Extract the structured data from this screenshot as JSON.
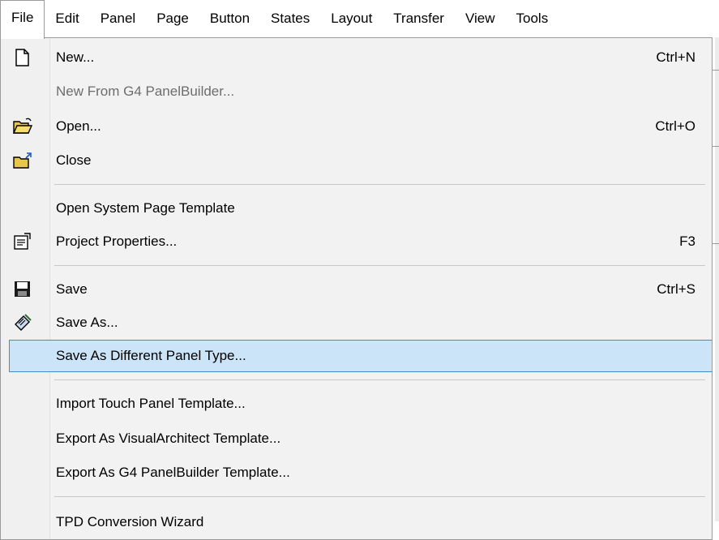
{
  "menubar": {
    "items": [
      {
        "label": "File"
      },
      {
        "label": "Edit"
      },
      {
        "label": "Panel"
      },
      {
        "label": "Page"
      },
      {
        "label": "Button"
      },
      {
        "label": "States"
      },
      {
        "label": "Layout"
      },
      {
        "label": "Transfer"
      },
      {
        "label": "View"
      },
      {
        "label": "Tools"
      }
    ]
  },
  "file_menu": {
    "items": [
      {
        "label": "New...",
        "shortcut": "Ctrl+N",
        "icon": "new-file-icon"
      },
      {
        "label": "New From G4 PanelBuilder...",
        "disabled": true
      },
      {
        "label": "Open...",
        "shortcut": "Ctrl+O",
        "icon": "open-folder-icon"
      },
      {
        "label": "Close",
        "icon": "close-folder-icon"
      },
      {
        "label": "Open System Page Template"
      },
      {
        "label": "Project Properties...",
        "shortcut": "F3",
        "icon": "properties-icon"
      },
      {
        "label": "Save",
        "shortcut": "Ctrl+S",
        "icon": "save-disk-icon"
      },
      {
        "label": "Save As...",
        "icon": "save-as-icon"
      },
      {
        "label": "Save As Different Panel Type...",
        "highlighted": true
      },
      {
        "label": "Import Touch Panel Template..."
      },
      {
        "label": "Export As VisualArchitect Template..."
      },
      {
        "label": "Export As G4 PanelBuilder Template..."
      },
      {
        "label": "TPD Conversion Wizard"
      }
    ]
  },
  "colors": {
    "highlight_bg": "#cce4f7",
    "highlight_border": "#3d8cd6",
    "menu_bg": "#f2f2f2",
    "disabled_text": "#6d6d6d"
  }
}
